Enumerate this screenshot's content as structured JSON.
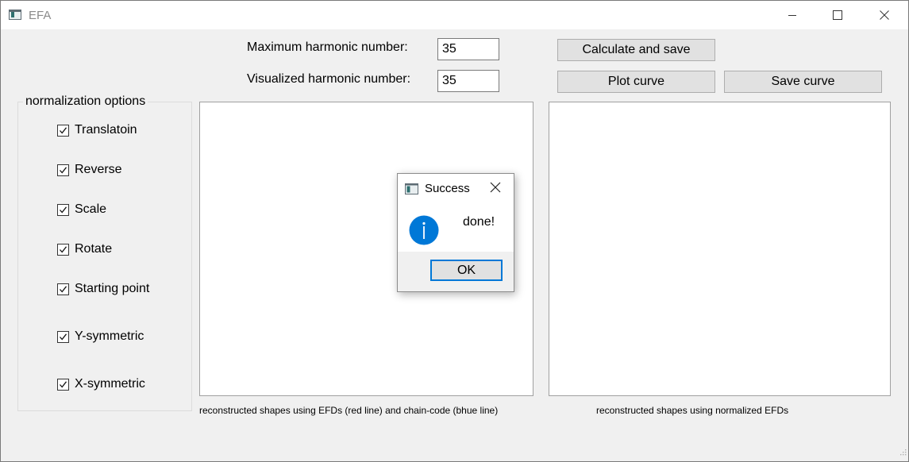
{
  "window": {
    "title": "EFA",
    "controls": [
      "minimize-icon",
      "maximize-icon",
      "close-icon"
    ]
  },
  "params": {
    "max_harmonic_label": "Maximum harmonic number:",
    "max_harmonic_value": "35",
    "vis_harmonic_label": "Visualized harmonic number:",
    "vis_harmonic_value": "35"
  },
  "buttons": {
    "calculate": "Calculate and save",
    "plot": "Plot curve",
    "save_curve": "Save curve"
  },
  "normalization": {
    "title": "normalization options",
    "options": [
      {
        "label": "Translatoin",
        "checked": true
      },
      {
        "label": "Reverse",
        "checked": true
      },
      {
        "label": "Scale",
        "checked": true
      },
      {
        "label": "Rotate",
        "checked": true
      },
      {
        "label": "Starting point",
        "checked": true
      },
      {
        "label": "Y-symmetric",
        "checked": true
      },
      {
        "label": "X-symmetric",
        "checked": true
      }
    ]
  },
  "plots": {
    "left_caption": "reconstructed shapes using EFDs (red line) and chain-code (bhue line)",
    "right_caption": "reconstructed shapes using normalized EFDs"
  },
  "dialog": {
    "title": "Success",
    "message": "done!",
    "ok": "OK",
    "icon": "info-icon",
    "accent": "#0078d7"
  }
}
